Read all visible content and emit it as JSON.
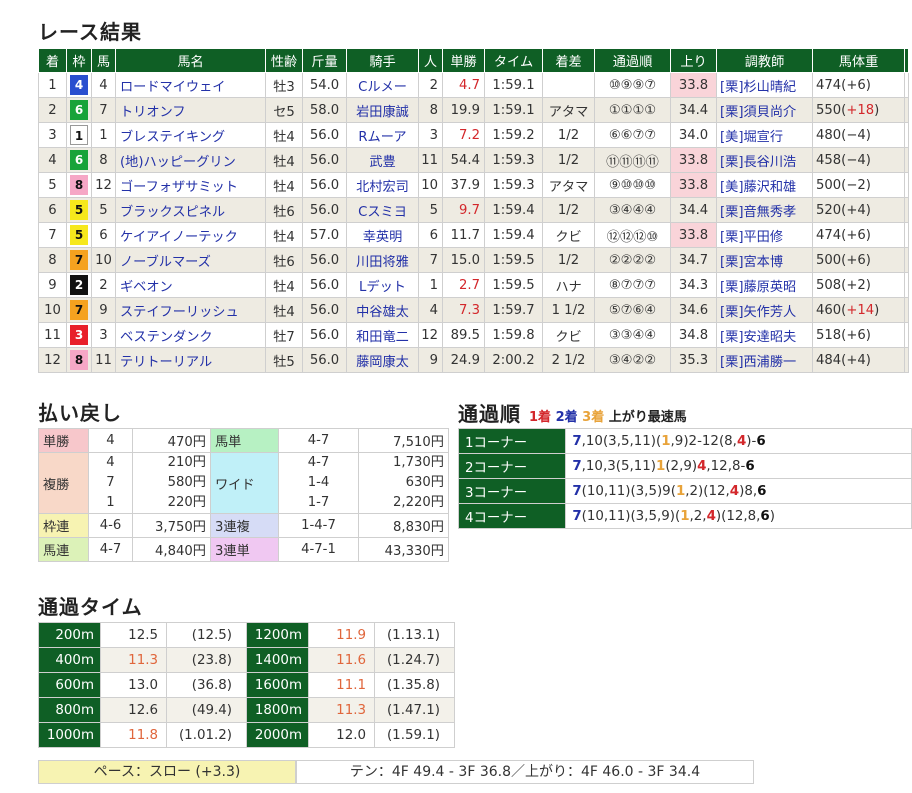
{
  "titles": {
    "result": "レース結果",
    "payout": "払い戻し",
    "passing": "通過順",
    "laps": "通過タイム"
  },
  "passing_legend": {
    "first": "1着",
    "second": "2着",
    "third": "3着",
    "fastest": "上がり最速馬"
  },
  "colors": {
    "header_green": "#0f5f25",
    "first_blue": "#2331a8",
    "second_red": "#d3272b",
    "third_orange": "#e8a33a"
  },
  "result_headers": [
    "着",
    "枠",
    "馬",
    "馬名",
    "性齢",
    "斤量",
    "騎手",
    "人",
    "単勝",
    "タイム",
    "着差",
    "通過順",
    "上り",
    "調教師",
    "馬体重"
  ],
  "results": [
    {
      "rank": "1",
      "frame": "4",
      "no": "4",
      "horse": "ロードマイウェイ",
      "sex_age": "牡3",
      "weight": "54.0",
      "jockey": "Cルメー",
      "pop": "2",
      "odds": "4.7",
      "time": "1:59.1",
      "margin": "",
      "passing": "⑩⑨⑨⑦",
      "last": "33.8",
      "trainer": "[栗]杉山晴紀",
      "body": "474(+6)"
    },
    {
      "rank": "2",
      "frame": "6",
      "no": "7",
      "horse": "トリオンフ",
      "sex_age": "セ5",
      "weight": "58.0",
      "jockey": "岩田康誠",
      "pop": "8",
      "odds": "19.9",
      "time": "1:59.1",
      "margin": "アタマ",
      "passing": "①①①①",
      "last": "34.4",
      "trainer": "[栗]須貝尚介",
      "body": "550(+18)"
    },
    {
      "rank": "3",
      "frame": "1",
      "no": "1",
      "horse": "ブレステイキング",
      "sex_age": "牡4",
      "weight": "56.0",
      "jockey": "Rムーア",
      "pop": "3",
      "odds": "7.2",
      "time": "1:59.2",
      "margin": "1/2",
      "passing": "⑥⑥⑦⑦",
      "last": "34.0",
      "trainer": "[美]堀宣行",
      "body": "480(−4)"
    },
    {
      "rank": "4",
      "frame": "6",
      "no": "8",
      "horse": "(地)ハッピーグリン",
      "sex_age": "牡4",
      "weight": "56.0",
      "jockey": "武豊",
      "pop": "11",
      "odds": "54.4",
      "time": "1:59.3",
      "margin": "1/2",
      "passing": "⑪⑪⑪⑪",
      "last": "33.8",
      "trainer": "[栗]長谷川浩",
      "body": "458(−4)"
    },
    {
      "rank": "5",
      "frame": "8",
      "no": "12",
      "horse": "ゴーフォザサミット",
      "sex_age": "牡4",
      "weight": "56.0",
      "jockey": "北村宏司",
      "pop": "10",
      "odds": "37.9",
      "time": "1:59.3",
      "margin": "アタマ",
      "passing": "⑨⑩⑩⑩",
      "last": "33.8",
      "trainer": "[美]藤沢和雄",
      "body": "500(−2)"
    },
    {
      "rank": "6",
      "frame": "5",
      "no": "5",
      "horse": "ブラックスピネル",
      "sex_age": "牡6",
      "weight": "56.0",
      "jockey": "Cスミヨ",
      "pop": "5",
      "odds": "9.7",
      "time": "1:59.4",
      "margin": "1/2",
      "passing": "③④④④",
      "last": "34.4",
      "trainer": "[栗]音無秀孝",
      "body": "520(+4)"
    },
    {
      "rank": "7",
      "frame": "5",
      "no": "6",
      "horse": "ケイアイノーテック",
      "sex_age": "牡4",
      "weight": "57.0",
      "jockey": "幸英明",
      "pop": "6",
      "odds": "11.7",
      "time": "1:59.4",
      "margin": "クビ",
      "passing": "⑫⑫⑫⑩",
      "last": "33.8",
      "trainer": "[栗]平田修",
      "body": "474(+6)"
    },
    {
      "rank": "8",
      "frame": "7",
      "no": "10",
      "horse": "ノーブルマーズ",
      "sex_age": "牡6",
      "weight": "56.0",
      "jockey": "川田将雅",
      "pop": "7",
      "odds": "15.0",
      "time": "1:59.5",
      "margin": "1/2",
      "passing": "②②②②",
      "last": "34.7",
      "trainer": "[栗]宮本博",
      "body": "500(+6)"
    },
    {
      "rank": "9",
      "frame": "2",
      "no": "2",
      "horse": "ギベオン",
      "sex_age": "牡4",
      "weight": "56.0",
      "jockey": "Lデット",
      "pop": "1",
      "odds": "2.7",
      "time": "1:59.5",
      "margin": "ハナ",
      "passing": "⑧⑦⑦⑦",
      "last": "34.3",
      "trainer": "[栗]藤原英昭",
      "body": "508(+2)"
    },
    {
      "rank": "10",
      "frame": "7",
      "no": "9",
      "horse": "ステイフーリッシュ",
      "sex_age": "牡4",
      "weight": "56.0",
      "jockey": "中谷雄太",
      "pop": "4",
      "odds": "7.3",
      "time": "1:59.7",
      "margin": "1 1/2",
      "passing": "⑤⑦⑥④",
      "last": "34.6",
      "trainer": "[栗]矢作芳人",
      "body": "460(+14)"
    },
    {
      "rank": "11",
      "frame": "3",
      "no": "3",
      "horse": "ベステンダンク",
      "sex_age": "牡7",
      "weight": "56.0",
      "jockey": "和田竜二",
      "pop": "12",
      "odds": "89.5",
      "time": "1:59.8",
      "margin": "クビ",
      "passing": "③③④④",
      "last": "34.8",
      "trainer": "[栗]安達昭夫",
      "body": "518(+6)"
    },
    {
      "rank": "12",
      "frame": "8",
      "no": "11",
      "horse": "テリトーリアル",
      "sex_age": "牡5",
      "weight": "56.0",
      "jockey": "藤岡康太",
      "pop": "9",
      "odds": "24.9",
      "time": "2:00.2",
      "margin": "2 1/2",
      "passing": "③④②②",
      "last": "35.3",
      "trainer": "[栗]西浦勝一",
      "body": "484(+4)"
    }
  ],
  "payouts": {
    "tansho": {
      "label": "単勝",
      "nums": [
        "4"
      ],
      "yen": [
        "470円"
      ]
    },
    "fukusho": {
      "label": "複勝",
      "nums": [
        "4",
        "7",
        "1"
      ],
      "yen": [
        "210円",
        "580円",
        "220円"
      ]
    },
    "wakuren": {
      "label": "枠連",
      "nums": [
        "4-6"
      ],
      "yen": [
        "3,750円"
      ]
    },
    "umaren": {
      "label": "馬連",
      "nums": [
        "4-7"
      ],
      "yen": [
        "4,840円"
      ]
    },
    "umatan": {
      "label": "馬単",
      "nums": [
        "4-7"
      ],
      "yen": [
        "7,510円"
      ]
    },
    "wide": {
      "label": "ワイド",
      "nums": [
        "4-7",
        "1-4",
        "1-7"
      ],
      "yen": [
        "1,730円",
        "630円",
        "2,220円"
      ]
    },
    "sanrenpuku": {
      "label": "3連複",
      "nums": [
        "1-4-7"
      ],
      "yen": [
        "8,830円"
      ]
    },
    "sanrentan": {
      "label": "3連単",
      "nums": [
        "4-7-1"
      ],
      "yen": [
        "43,330円"
      ]
    }
  },
  "corners": [
    {
      "name": "1コーナー"
    },
    {
      "name": "2コーナー"
    },
    {
      "name": "3コーナー"
    },
    {
      "name": "4コーナー"
    }
  ],
  "laps": [
    {
      "dist": "200m",
      "lap": "12.5",
      "cum": "(12.5)"
    },
    {
      "dist": "400m",
      "lap": "11.3",
      "cum": "(23.8)"
    },
    {
      "dist": "600m",
      "lap": "13.0",
      "cum": "(36.8)"
    },
    {
      "dist": "800m",
      "lap": "12.6",
      "cum": "(49.4)"
    },
    {
      "dist": "1000m",
      "lap": "11.8",
      "cum": "(1.01.2)"
    },
    {
      "dist": "1200m",
      "lap": "11.9",
      "cum": "(1.13.1)"
    },
    {
      "dist": "1400m",
      "lap": "11.6",
      "cum": "(1.24.7)"
    },
    {
      "dist": "1600m",
      "lap": "11.1",
      "cum": "(1.35.8)"
    },
    {
      "dist": "1800m",
      "lap": "11.3",
      "cum": "(1.47.1)"
    },
    {
      "dist": "2000m",
      "lap": "12.0",
      "cum": "(1.59.1)"
    }
  ],
  "pace": "ペース：スロー (+3.3)",
  "ten_agari": "テン：4F 49.4 - 3F 36.8／上がり：4F 46.0 - 3F 34.4"
}
